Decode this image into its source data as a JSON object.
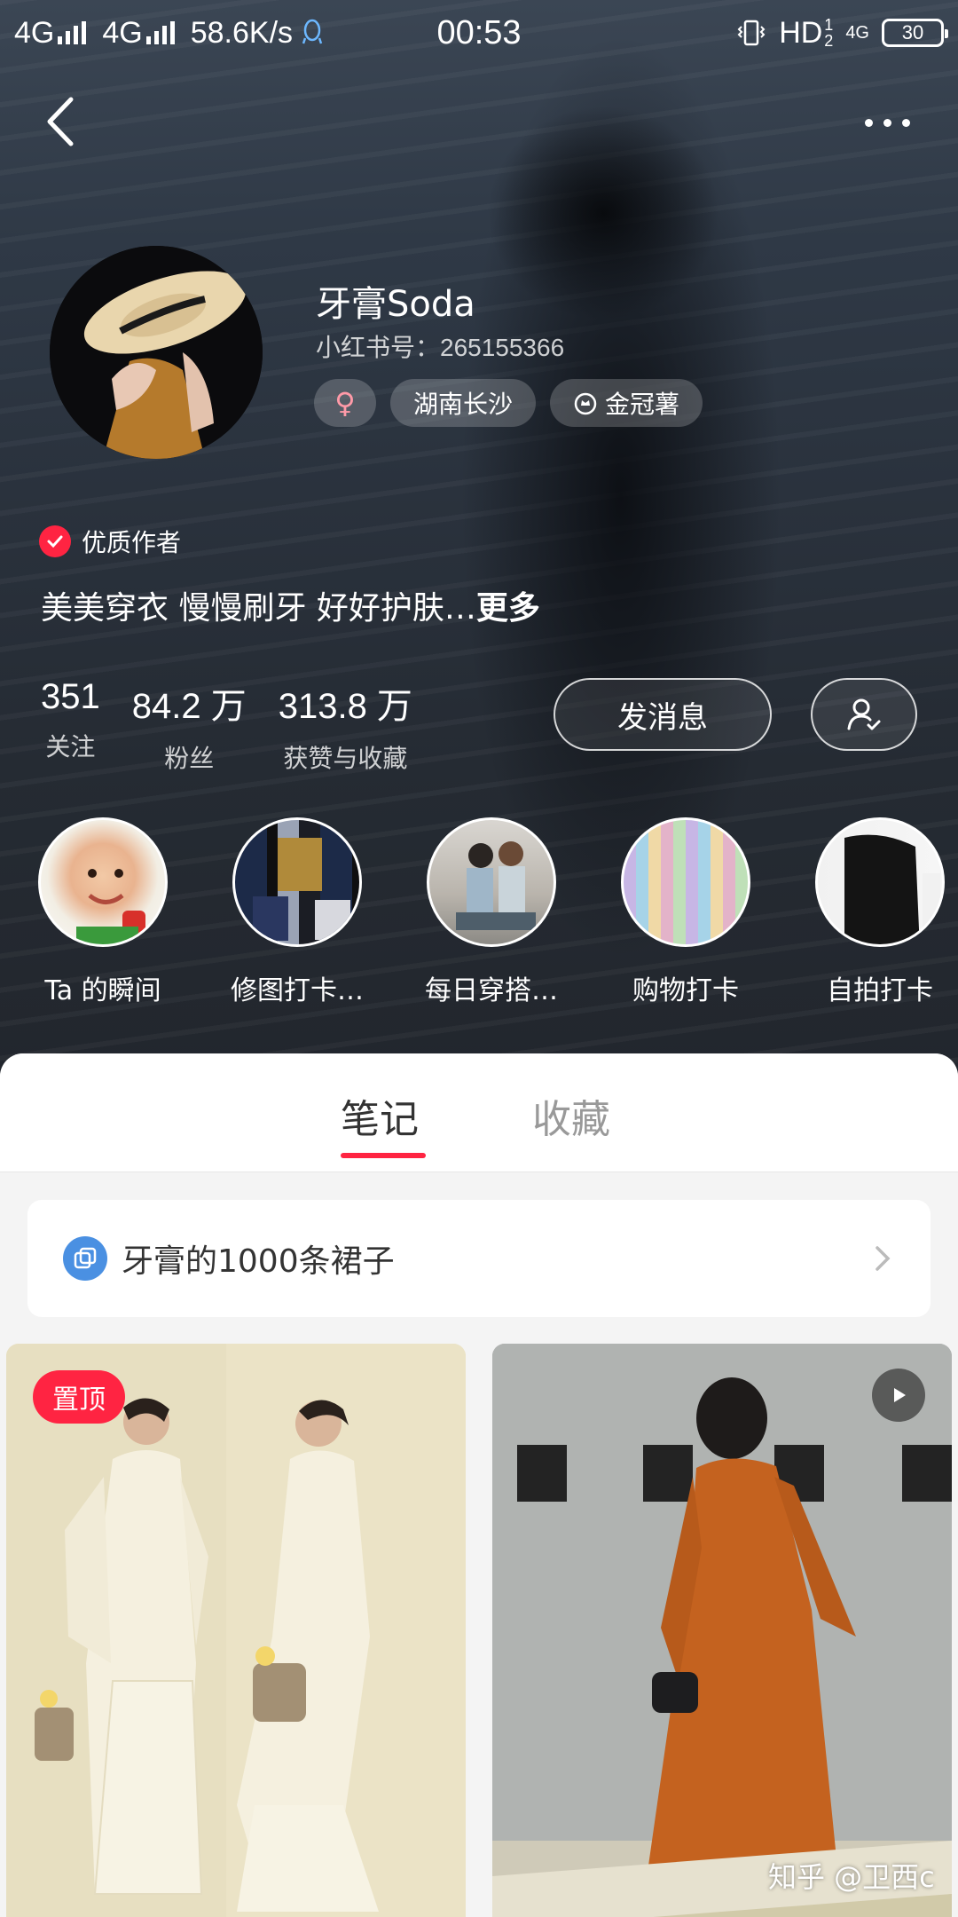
{
  "status_bar": {
    "network1": "4G",
    "network2": "4G",
    "speed": "58.6K/s",
    "time": "00:53",
    "hd": "HD",
    "hd_sub": "1",
    "hd_sub2": "2",
    "net3": "4G",
    "battery": "30"
  },
  "profile": {
    "name": "牙膏Soda",
    "red_id": "小红书号：265155366",
    "gender_symbol": "♀",
    "location": "湖南长沙",
    "badge": "金冠薯",
    "quality_label": "优质作者",
    "bio": "美美穿衣 慢慢刷牙 好好护肤…",
    "bio_more": "更多"
  },
  "stats": [
    {
      "num": "351",
      "label": "关注"
    },
    {
      "num": "84.2 万",
      "label": "粉丝"
    },
    {
      "num": "313.8 万",
      "label": "获赞与收藏"
    }
  ],
  "actions": {
    "message": "发消息"
  },
  "highlights": [
    {
      "label": "Ta 的瞬间"
    },
    {
      "label": "修图打卡…"
    },
    {
      "label": "每日穿搭…"
    },
    {
      "label": "购物打卡"
    },
    {
      "label": "自拍打卡"
    }
  ],
  "tabs": {
    "notes": "笔记",
    "collections": "收藏"
  },
  "collection": {
    "title": "牙膏的1000条裙子"
  },
  "cards": {
    "pinned_label": "置顶"
  },
  "watermark": "知乎 @卫西c",
  "colors": {
    "accent": "#ff2442",
    "collection_icon": "#4a90e2"
  }
}
